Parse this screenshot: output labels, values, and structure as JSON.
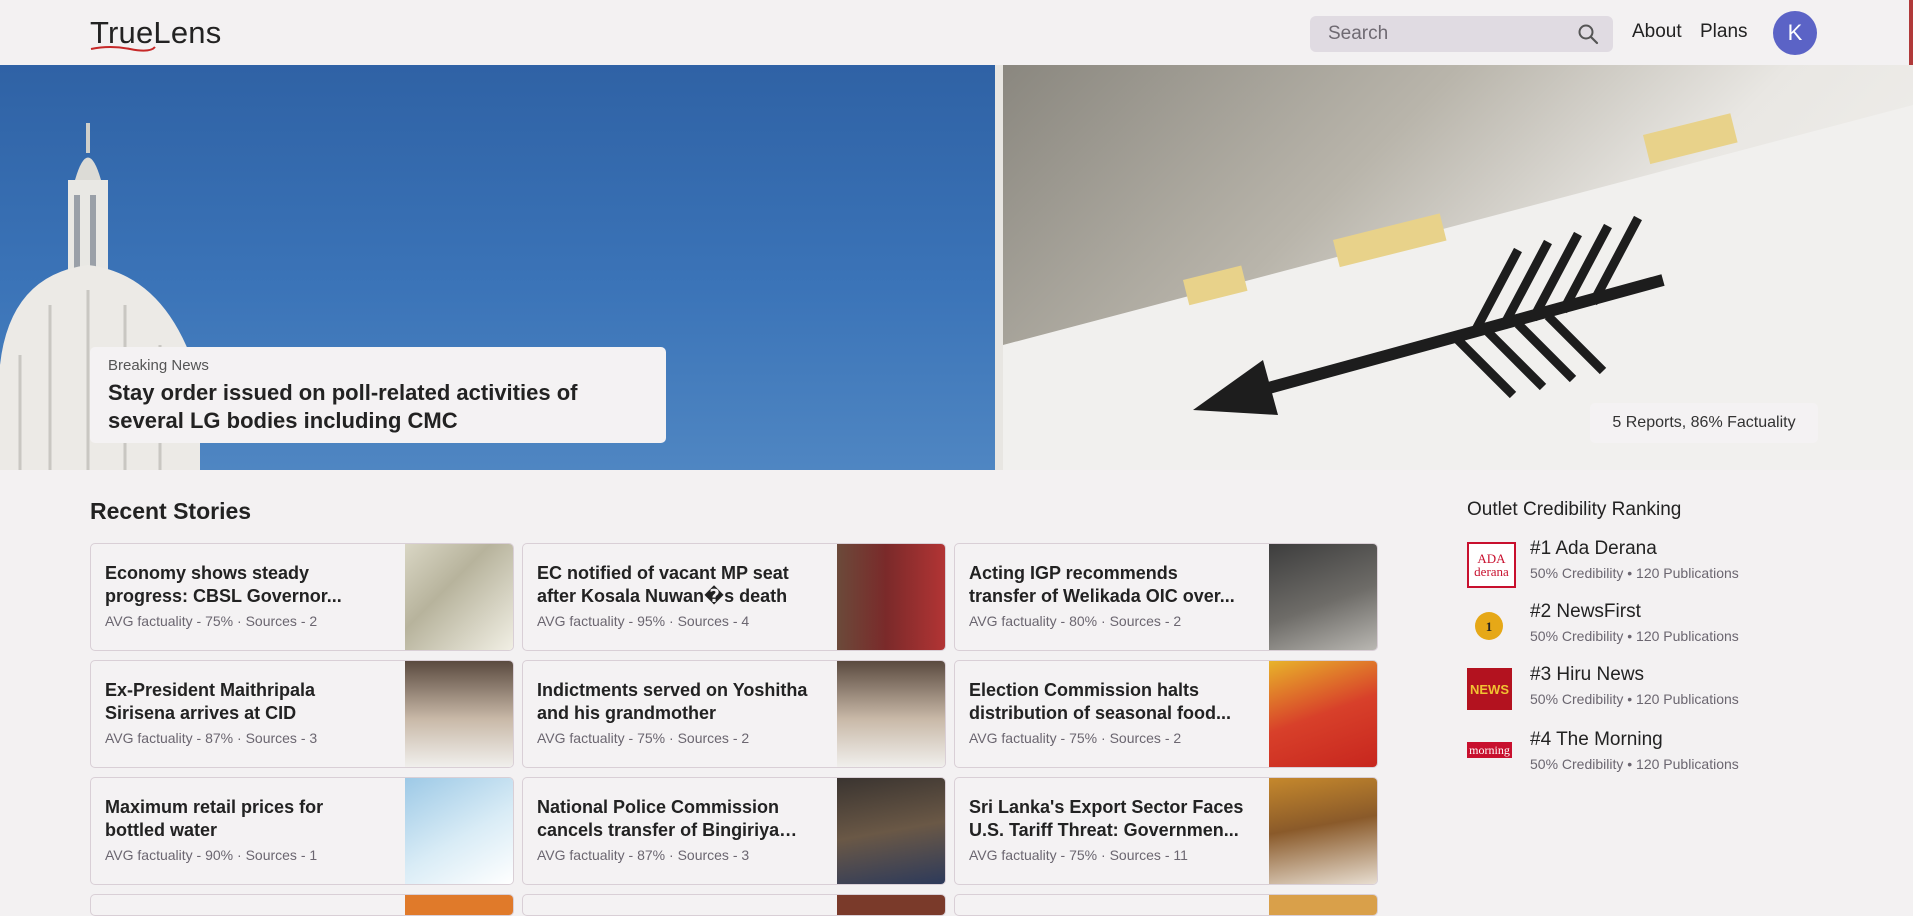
{
  "header": {
    "logo": "TrueLens",
    "search_placeholder": "Search",
    "nav": [
      {
        "label": "About"
      },
      {
        "label": "Plans"
      }
    ],
    "avatar_initial": "K"
  },
  "hero": {
    "kicker": "Breaking News",
    "title": "Stay order issued on poll-related activities of several LG bodies including CMC",
    "badge": "5 Reports, 86% Factuality"
  },
  "recent": {
    "title": "Recent Stories",
    "cards": [
      {
        "title": "Economy shows steady progress: CBSL Governor...",
        "meta": "AVG factuality - 75% · Sources - 2",
        "thumb": "money-icon"
      },
      {
        "title": "EC notified of vacant MP seat after Kosala Nuwan�s death",
        "meta": "AVG factuality - 95% · Sources - 4",
        "thumb": "parliament-icon"
      },
      {
        "title": "Acting IGP recommends transfer of Welikada OIC over...",
        "meta": "AVG factuality - 80% · Sources - 2",
        "thumb": "crowd-icon"
      },
      {
        "title": "Ex-President Maithripala Sirisena arrives at CID",
        "meta": "AVG factuality - 87% · Sources - 3",
        "thumb": "portrait-icon"
      },
      {
        "title": "Indictments served on Yoshitha and his grandmother",
        "meta": "AVG factuality - 75% · Sources - 2",
        "thumb": "portrait-icon"
      },
      {
        "title": "Election Commission halts distribution of seasonal food...",
        "meta": "AVG factuality - 75% · Sources - 2",
        "thumb": "food-bag-icon"
      },
      {
        "title": "Maximum retail prices for bottled water",
        "meta": "AVG factuality - 90% · Sources - 1",
        "thumb": "water-bottle-icon"
      },
      {
        "title": "National Police Commission cancels transfer of Bingiriya OIC",
        "meta": "AVG factuality - 87% · Sources - 3",
        "thumb": "police-icon"
      },
      {
        "title": "Sri Lanka's Export Sector Faces U.S. Tariff Threat: Governmen...",
        "meta": "AVG factuality - 75% · Sources - 11",
        "thumb": "meeting-icon"
      }
    ]
  },
  "sidebar": {
    "title": "Outlet Credibility Ranking",
    "outlets": [
      {
        "name": "#1 Ada Derana",
        "sub": "50% Credibility • 120 Publications",
        "logo_text": "ADA derana",
        "color": "#c8102e"
      },
      {
        "name": "#2 NewsFirst",
        "sub": "50% Credibility • 120 Publications",
        "logo_text": "1",
        "color": "#e6a817"
      },
      {
        "name": "#3 Hiru News",
        "sub": "50% Credibility • 120 Publications",
        "logo_text": "NEWS",
        "color": "#b3121f"
      },
      {
        "name": "#4 The Morning",
        "sub": "50% Credibility • 120 Publications",
        "logo_text": "morning",
        "color": "#c8102e"
      }
    ]
  }
}
